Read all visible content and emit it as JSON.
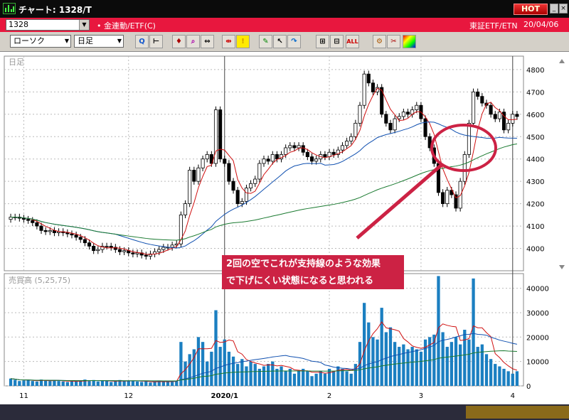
{
  "window": {
    "title": "チャート: 1328/T",
    "hot_label": "HOT",
    "minimize": "_",
    "maximize": "□",
    "close": "×"
  },
  "symbol_bar": {
    "code": "1328",
    "name": "金連動/ETF(C)",
    "type": "東証ETF/ETN",
    "date": "20/04/06"
  },
  "toolbar": {
    "chart_type": "ローソク",
    "period": "日足"
  },
  "colors": {
    "title_bg": "#0b0b0b",
    "symbol_bar_bg": "#e8173e",
    "hot": "#cc1111",
    "annotation": "#cc2244",
    "volume_bar": "#1b7fc1",
    "ma_short": "#d01010",
    "ma_mid": "#1050b0",
    "ma_long": "#1a7a30"
  },
  "chart_data": {
    "type": "candlestick",
    "price_panel_label": "日足",
    "volume_panel_label": "売買高 (5,25,75)",
    "price_axis": {
      "ylim": [
        3900,
        4860
      ],
      "ticks": [
        4000,
        4100,
        4200,
        4300,
        4400,
        4500,
        4600,
        4700,
        4800
      ]
    },
    "volume_axis": {
      "ylim": [
        0,
        46000
      ],
      "ticks": [
        "0",
        "10000",
        "20000",
        "30000",
        "40000"
      ]
    },
    "x_tick_labels": [
      "11",
      "12",
      "2020/1",
      "2",
      "3",
      "4"
    ],
    "annotation_lines": [
      "2回の空でこれが支持線のような効果",
      "で下げにくい状態になると思われる"
    ],
    "closes": [
      4140,
      4140,
      4135,
      4130,
      4125,
      4115,
      4100,
      4080,
      4075,
      4080,
      4070,
      4075,
      4070,
      4065,
      4060,
      4050,
      4040,
      4025,
      4010,
      3990,
      3995,
      4010,
      4010,
      4005,
      3995,
      3985,
      3990,
      3980,
      3975,
      3980,
      3970,
      3965,
      3975,
      3985,
      3995,
      4005,
      4005,
      4015,
      4020,
      4150,
      4200,
      4350,
      4300,
      4360,
      4400,
      4420,
      4380,
      4620,
      4400,
      4380,
      4300,
      4260,
      4200,
      4210,
      4270,
      4290,
      4310,
      4380,
      4400,
      4390,
      4420,
      4400,
      4420,
      4450,
      4460,
      4450,
      4460,
      4430,
      4410,
      4390,
      4400,
      4420,
      4410,
      4430,
      4420,
      4440,
      4460,
      4480,
      4500,
      4560,
      4640,
      4780,
      4740,
      4700,
      4720,
      4600,
      4560,
      4530,
      4580,
      4590,
      4610,
      4600,
      4620,
      4640,
      4580,
      4500,
      4450,
      4380,
      4250,
      4200,
      4260,
      4240,
      4180,
      4300,
      4420,
      4560,
      4700,
      4680,
      4650,
      4640,
      4600,
      4580,
      4610,
      4530,
      4560,
      4600,
      4590
    ],
    "volumes": [
      3000,
      2500,
      2000,
      2200,
      2500,
      2000,
      1800,
      2600,
      2200,
      2000,
      2400,
      2000,
      1800,
      1600,
      2000,
      1800,
      2200,
      2600,
      2000,
      2400,
      1800,
      2200,
      2000,
      1600,
      1800,
      2400,
      2000,
      2200,
      2000,
      1800,
      1600,
      2000,
      1400,
      1600,
      2200,
      1800,
      1600,
      1700,
      1900,
      18000,
      10000,
      13000,
      15000,
      20000,
      18000,
      10000,
      14000,
      31000,
      16000,
      19000,
      14000,
      12000,
      9000,
      11000,
      8000,
      10000,
      9000,
      7000,
      8000,
      9000,
      10000,
      7000,
      8000,
      6000,
      7000,
      5000,
      6000,
      7000,
      6000,
      4000,
      5000,
      6000,
      5000,
      7000,
      6000,
      8000,
      7000,
      6000,
      5000,
      9000,
      18000,
      34000,
      26000,
      20000,
      19000,
      32000,
      22000,
      24000,
      18000,
      16000,
      17000,
      15000,
      16000,
      15000,
      14000,
      19000,
      20000,
      21000,
      45000,
      22000,
      16000,
      18000,
      20000,
      17000,
      23000,
      19000,
      44000,
      16000,
      17000,
      13000,
      11000,
      9000,
      8000,
      7000,
      6000,
      5000,
      6000
    ]
  }
}
